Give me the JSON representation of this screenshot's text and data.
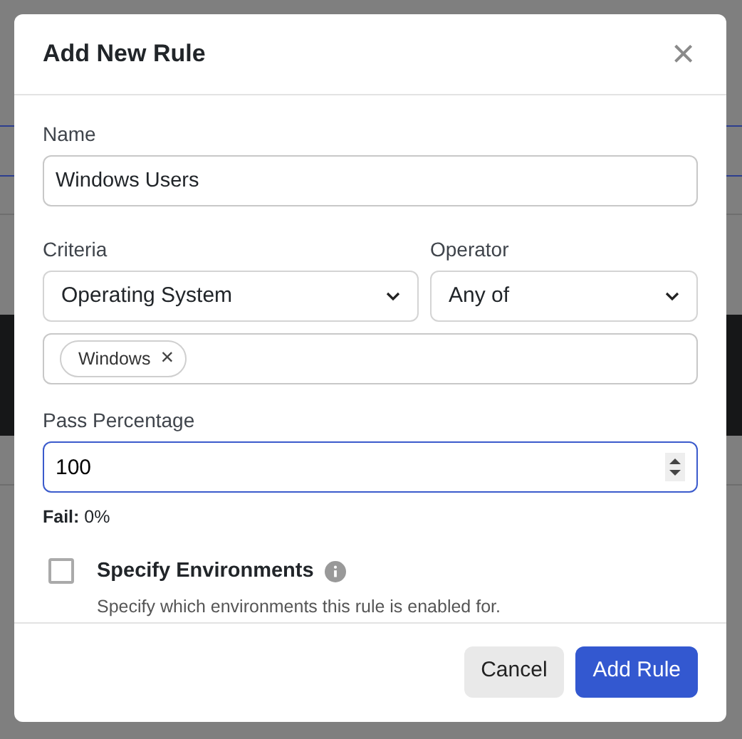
{
  "modal": {
    "title": "Add New Rule",
    "close": "×"
  },
  "name_field": {
    "label": "Name",
    "value": "Windows Users"
  },
  "criteria": {
    "label": "Criteria",
    "value": "Operating System"
  },
  "operator": {
    "label": "Operator",
    "value": "Any of"
  },
  "tags": [
    {
      "label": "Windows",
      "remove": "×"
    }
  ],
  "pass_percentage": {
    "label": "Pass Percentage",
    "value": "100",
    "focused": true
  },
  "fail_note": "**Fail:** 0%",
  "environments": {
    "label": "Specify Environments",
    "checked": false,
    "help": "Specify which environments this rule is enabled for."
  },
  "buttons": [
    {
      "kind": "secondary",
      "label": "Cancel"
    },
    {
      "kind": "primary",
      "label": "Add Rule"
    }
  ]
}
